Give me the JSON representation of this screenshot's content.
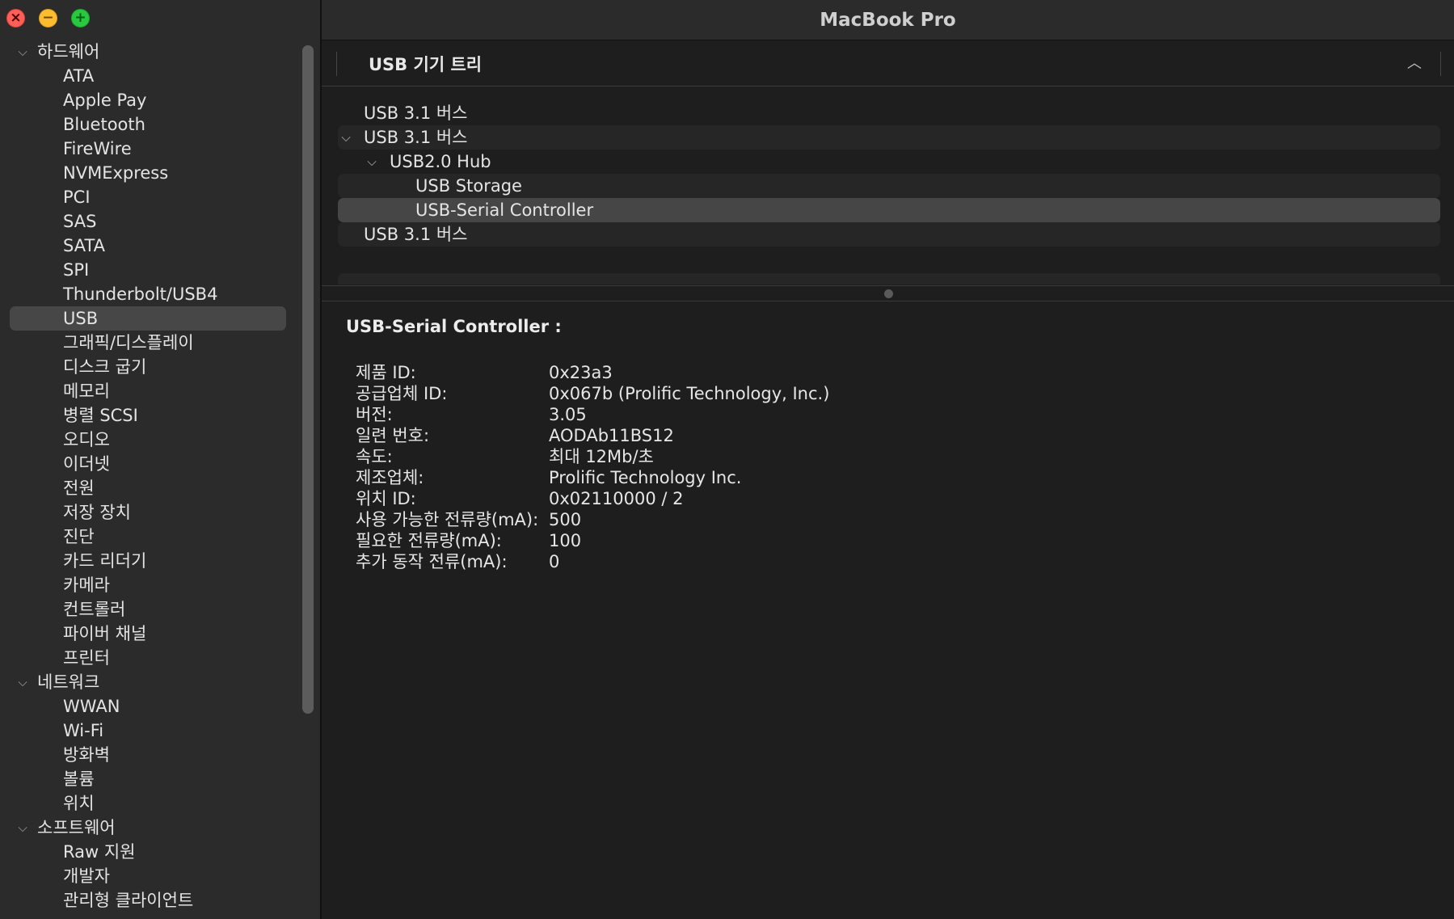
{
  "window": {
    "title": "MacBook Pro",
    "buttons": {
      "close": "×",
      "minimize": "−",
      "zoom": "+"
    }
  },
  "sidebar": {
    "groups": [
      {
        "label": "하드웨어",
        "items": [
          "ATA",
          "Apple Pay",
          "Bluetooth",
          "FireWire",
          "NVMExpress",
          "PCI",
          "SAS",
          "SATA",
          "SPI",
          "Thunderbolt/USB4",
          "USB",
          "그래픽/디스플레이",
          "디스크 굽기",
          "메모리",
          "병렬 SCSI",
          "오디오",
          "이더넷",
          "전원",
          "저장 장치",
          "진단",
          "카드 리더기",
          "카메라",
          "컨트롤러",
          "파이버 채널",
          "프린터"
        ]
      },
      {
        "label": "네트워크",
        "items": [
          "WWAN",
          "Wi-Fi",
          "방화벽",
          "볼륨",
          "위치"
        ]
      },
      {
        "label": "소프트웨어",
        "items": [
          "Raw 지원",
          "개발자",
          "관리형 클라이언트"
        ]
      }
    ],
    "selected": "USB"
  },
  "tree": {
    "header": "USB 기기 트리",
    "rows": [
      {
        "label": "USB 3.1 버스",
        "level": 0,
        "expanded": false
      },
      {
        "label": "USB 3.1 버스",
        "level": 0,
        "expanded": true
      },
      {
        "label": "USB2.0 Hub",
        "level": 1,
        "expanded": true
      },
      {
        "label": "USB Storage",
        "level": 2
      },
      {
        "label": "USB-Serial Controller",
        "level": 2,
        "selected": true
      },
      {
        "label": "USB 3.1 버스",
        "level": 0,
        "expanded": false
      }
    ]
  },
  "detail": {
    "title": "USB-Serial Controller :",
    "fields": [
      {
        "key": "제품 ID:",
        "value": "0x23a3"
      },
      {
        "key": "공급업체 ID:",
        "value": "0x067b  (Prolific Technology, Inc.)"
      },
      {
        "key": "버전:",
        "value": "3.05"
      },
      {
        "key": "일련 번호:",
        "value": "AODAb11BS12"
      },
      {
        "key": "속도:",
        "value": "최대 12Mb/초"
      },
      {
        "key": "제조업체:",
        "value": "Prolific Technology Inc."
      },
      {
        "key": "위치 ID:",
        "value": "0x02110000 / 2"
      },
      {
        "key": "사용 가능한 전류량(mA):",
        "value": "500"
      },
      {
        "key": "필요한 전류량(mA):",
        "value": "100"
      },
      {
        "key": "추가 동작 전류(mA):",
        "value": "0"
      }
    ]
  },
  "colors": {
    "sidebar_bg": "#2b2b2b",
    "content_bg": "#1e1e1e",
    "selection": "#474747",
    "close": "#ff5f57",
    "minimize": "#febc2e",
    "zoom": "#28c840"
  }
}
